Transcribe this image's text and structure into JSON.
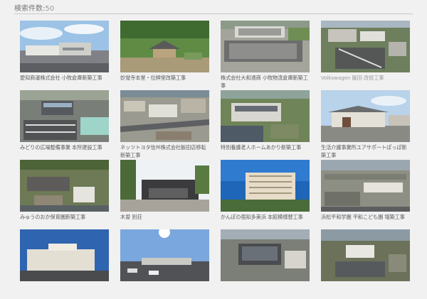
{
  "header": {
    "label": "検索件数:",
    "count": "50"
  },
  "cards": [
    {
      "caption": "愛知商運株式会社 小牧倉庫新築工事",
      "scene": "warehouse-sky"
    },
    {
      "caption": "妙覚寺本堂・位牌堂改築工事",
      "scene": "temple-green"
    },
    {
      "caption": "株式会社大和通商 小牧物流倉庫新築工事",
      "scene": "aerial-warehouse"
    },
    {
      "caption": "Volkswagen 飯田 改修工事",
      "scene": "aerial-town",
      "light": true
    },
    {
      "caption": "みどりの広場整備事業 本所建設工事",
      "scene": "aerial-parking"
    },
    {
      "caption": "ネッツトヨタ信州株式会社飯田店移転新築工事",
      "scene": "aerial-city"
    },
    {
      "caption": "特別養護老人ホームあかり新築工事",
      "scene": "aerial-home"
    },
    {
      "caption": "生活介護事業所ユアサポートぽっぽ新築工事",
      "scene": "house-sky"
    },
    {
      "caption": "みゅうのおか保育園新築工事",
      "scene": "aerial-nursery"
    },
    {
      "caption": "木曽 別荘",
      "scene": "villa"
    },
    {
      "caption": "かんぽの宿知多美浜 本館模様替工事",
      "scene": "hotel"
    },
    {
      "caption": "浜松平和学園 平和こども園 増築工事",
      "scene": "aerial-school"
    },
    {
      "caption": "",
      "scene": "building-blue"
    },
    {
      "caption": "",
      "scene": "parking-sun"
    },
    {
      "caption": "",
      "scene": "aerial-factory"
    },
    {
      "caption": "",
      "scene": "aerial-plant"
    }
  ]
}
